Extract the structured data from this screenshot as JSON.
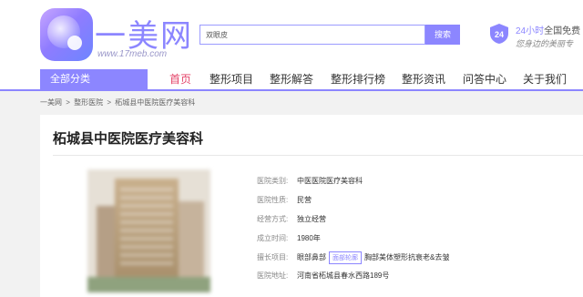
{
  "header": {
    "logo_text": "一美网",
    "logo_url": "www.17meb.com",
    "search": {
      "value": "双眼皮",
      "button": "搜索"
    },
    "service": {
      "title_highlight": "24小时",
      "title_rest": "全国免费",
      "subtitle": "您身边的美丽专"
    }
  },
  "nav": {
    "all_categories": "全部分类",
    "items": [
      "首页",
      "整形项目",
      "整形解答",
      "整形排行榜",
      "整形资讯",
      "问答中心",
      "关于我们"
    ]
  },
  "breadcrumb": [
    "一美网",
    ">",
    "整形医院",
    ">",
    "柘城县中医院医疗美容科"
  ],
  "hospital": {
    "title": "柘城县中医院医疗美容科",
    "info": {
      "type_label": "医院类别:",
      "type_value": "中医医院医疗美容科",
      "nature_label": "医院性质:",
      "nature_value": "民营",
      "mode_label": "经营方式:",
      "mode_value": "独立经营",
      "founded_label": "成立时间:",
      "founded_value": "1980年",
      "specialty_label": "擅长项目:",
      "specialty_a": "眼部鼻部",
      "specialty_tag": "面部轮廓",
      "specialty_b": "胸部美体塑形抗衰老&去皱",
      "address_label": "医院地址:",
      "address_value": "河南省柘城县春水西路189号"
    }
  }
}
